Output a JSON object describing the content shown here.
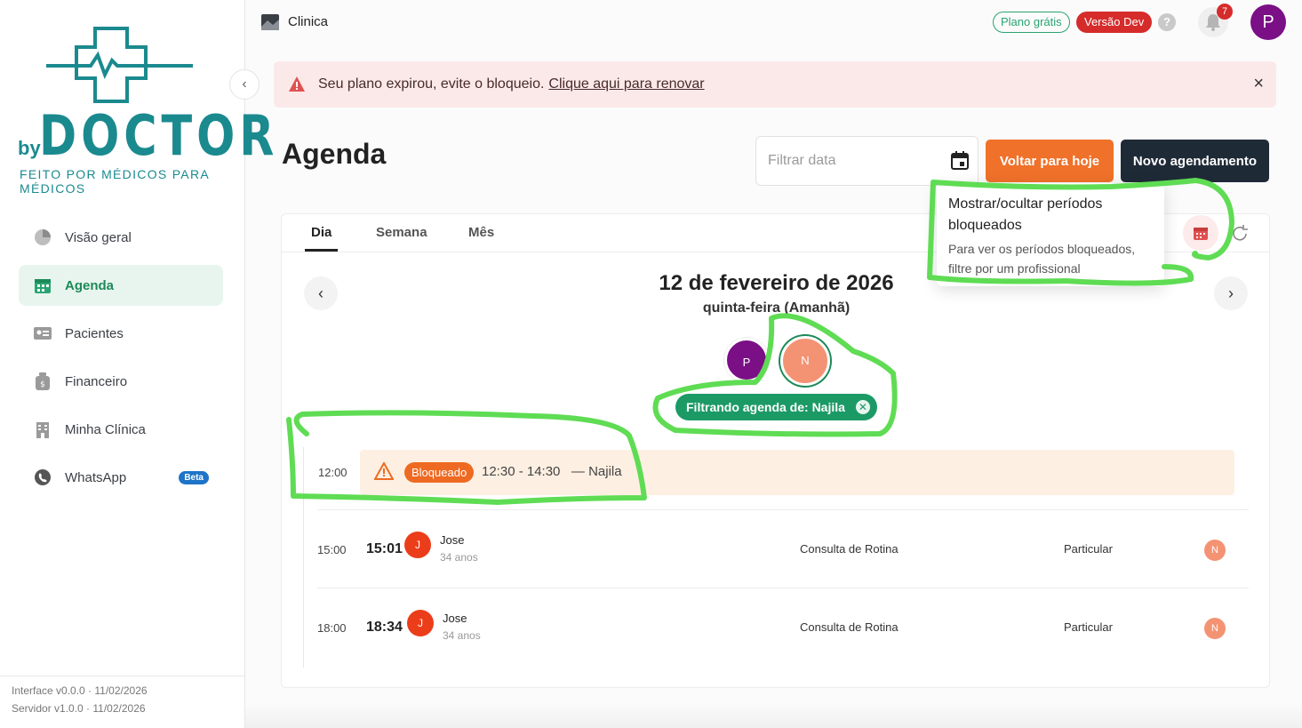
{
  "brand": {
    "by": "by",
    "name": "DOCTOR",
    "tagline": "FEITO POR MÉDICOS PARA MÉDICOS",
    "color": "#1b8a8f"
  },
  "sidebar": {
    "items": [
      {
        "label": "Visão geral",
        "icon": "pie-chart-icon"
      },
      {
        "label": "Agenda",
        "icon": "calendar-icon",
        "active": true
      },
      {
        "label": "Pacientes",
        "icon": "id-card-icon"
      },
      {
        "label": "Financeiro",
        "icon": "money-bag-icon"
      },
      {
        "label": "Minha Clínica",
        "icon": "building-icon"
      },
      {
        "label": "WhatsApp",
        "icon": "whatsapp-icon",
        "badge": "Beta"
      }
    ],
    "version_interface": "Interface v0.0.0 · 11/02/2026",
    "version_server": "Servidor v1.0.0 · 11/02/2026"
  },
  "topbar": {
    "clinic": "Clinica",
    "plan_badge": "Plano grátis",
    "dev_badge": "Versão Dev",
    "help": "?",
    "notifications": "7",
    "user_initial": "P"
  },
  "alert": {
    "message": "Seu plano expirou, evite o bloqueio.",
    "link": "Clique aqui para renovar",
    "close": "×"
  },
  "header": {
    "title": "Agenda",
    "date_placeholder": "Filtrar data",
    "today_button": "Voltar para hoje",
    "new_button": "Novo agendamento"
  },
  "tabs": [
    "Dia",
    "Semana",
    "Mês"
  ],
  "day": {
    "date": "12 de fevereiro de 2026",
    "weekday": "quinta-feira (Amanhã)",
    "professionals": [
      "P",
      "N"
    ],
    "filter_chip": "Filtrando agenda de: Najila"
  },
  "blocked": {
    "time": "12:00",
    "badge": "Bloqueado",
    "range": "12:30 - 14:30",
    "who": "— Najila"
  },
  "appointments": [
    {
      "slot": "15:00",
      "hour": "15:01",
      "initial": "J",
      "name": "Jose",
      "age": "34 anos",
      "type": "Consulta de Rotina",
      "payment": "Particular",
      "prof": "N"
    },
    {
      "slot": "18:00",
      "hour": "18:34",
      "initial": "J",
      "name": "Jose",
      "age": "34 anos",
      "type": "Consulta de Rotina",
      "payment": "Particular",
      "prof": "N"
    }
  ],
  "tooltip": {
    "title": "Mostrar/ocultar períodos bloqueados",
    "body": "Para ver os períodos bloqueados, filtre por um profissional"
  },
  "colors": {
    "accent_green": "#1c8a58",
    "orange": "#f0712a",
    "dark": "#1f2a37",
    "danger": "#d62b2b",
    "annotation": "#5fdc54"
  }
}
